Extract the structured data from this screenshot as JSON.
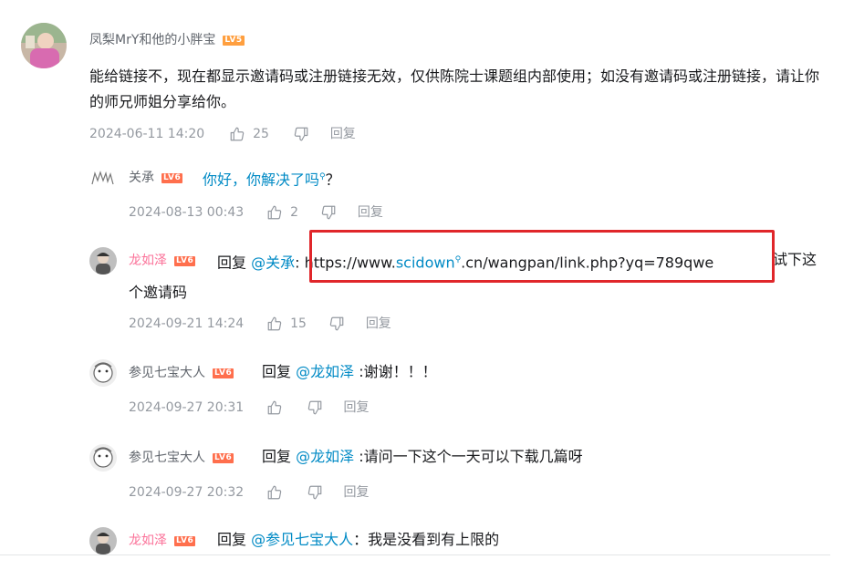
{
  "comment": {
    "username": "凤梨MrY和他的小胖宝",
    "level": "LV5",
    "content": "能给链接不，现在都显示邀请码或注册链接无效，仅供陈院士课题组内部使用；如没有邀请码或注册链接，请让你的师兄师姐分享给你。",
    "date": "2024-06-11 14:20",
    "likes": "25",
    "reply_label": "回复"
  },
  "replies": [
    {
      "username": "关承",
      "level": "LV6",
      "content_link": "你好，你解决了吗",
      "content_tail": "？",
      "date": "2024-08-13 00:43",
      "likes": "2",
      "reply_label": "回复"
    },
    {
      "username": "龙如泽",
      "level": "LV6",
      "reply_prefix": "回复",
      "mention": "@关承",
      "url_pre": ": https://www.",
      "url_link": "scidown",
      "url_post": ".cn/wangpan/link.php?yq=789qwe",
      "tail_line1": "试下这",
      "tail_line2": "个邀请码",
      "date": "2024-09-21 14:24",
      "likes": "15",
      "reply_label": "回复"
    },
    {
      "username": "参见七宝大人",
      "level": "LV6",
      "reply_prefix": "回复",
      "mention": "@龙如泽",
      "content": ":谢谢！！！",
      "date": "2024-09-27 20:31",
      "reply_label": "回复"
    },
    {
      "username": "参见七宝大人",
      "level": "LV6",
      "reply_prefix": "回复",
      "mention": "@龙如泽",
      "content": ":请问一下这个一天可以下载几篇呀",
      "date": "2024-09-27 20:32",
      "reply_label": "回复"
    },
    {
      "username": "龙如泽",
      "level": "LV6",
      "reply_prefix": "回复",
      "mention": "@参见七宝大人",
      "content": "：我是没看到有上限的"
    }
  ],
  "colors": {
    "link": "#008ac5",
    "meta": "#9499a0",
    "highlight_box": "#e0262a",
    "vip_name": "#fb7299"
  },
  "icons": [
    "search-icon",
    "thumbs-up-icon",
    "thumbs-down-icon"
  ]
}
